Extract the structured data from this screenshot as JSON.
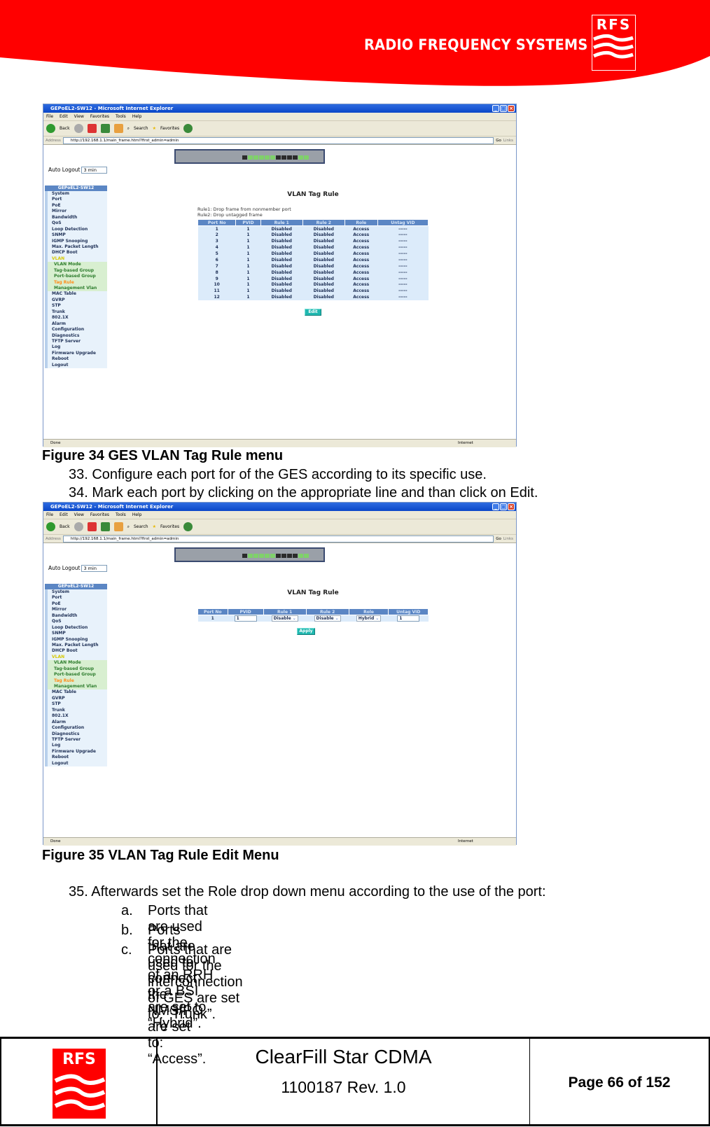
{
  "header": {
    "brand": "RADIO FREQUENCY SYSTEMS",
    "logo_text": "RFS",
    "brand_color": "#ff0000"
  },
  "browser": {
    "title": "GEPoEL2-SW12 - Microsoft Internet Explorer",
    "menu": [
      "File",
      "Edit",
      "View",
      "Favorites",
      "Tools",
      "Help"
    ],
    "toolbar": {
      "back": "Back",
      "search": "Search",
      "favorites": "Favorites"
    },
    "address_label": "Address",
    "url": "http://192.168.1.1/main_frame.html?first_admin=admin",
    "go": "Go",
    "links": "Links",
    "status": "Done",
    "zone": "Internet"
  },
  "app": {
    "auto_logout_label": "Auto Logout",
    "auto_logout_value": "3 min",
    "sidebar_title": "GEPoEL2-SW12",
    "sidebar": [
      {
        "label": "System"
      },
      {
        "label": "Port"
      },
      {
        "label": "PoE"
      },
      {
        "label": "Mirror"
      },
      {
        "label": "Bandwidth"
      },
      {
        "label": "QoS"
      },
      {
        "label": "Loop Detection"
      },
      {
        "label": "SNMP"
      },
      {
        "label": "IGMP Snooping"
      },
      {
        "label": "Max. Packet Length"
      },
      {
        "label": "DHCP Boot"
      },
      {
        "label": "VLAN",
        "type": "vlan"
      },
      {
        "label": "VLAN Mode",
        "type": "sub"
      },
      {
        "label": "Tag-based Group",
        "type": "sub"
      },
      {
        "label": "Port-based Group",
        "type": "sub"
      },
      {
        "label": "Tag Rule",
        "type": "sub active"
      },
      {
        "label": "Management Vlan",
        "type": "sub"
      },
      {
        "label": "MAC Table"
      },
      {
        "label": "GVRP"
      },
      {
        "label": "STP"
      },
      {
        "label": "Trunk"
      },
      {
        "label": "802.1X"
      },
      {
        "label": "Alarm"
      },
      {
        "label": "Configuration"
      },
      {
        "label": "Diagnostics"
      },
      {
        "label": "TFTP Server"
      },
      {
        "label": "Log"
      },
      {
        "label": "Firmware Upgrade"
      },
      {
        "label": "Reboot"
      },
      {
        "label": "Logout"
      }
    ],
    "page_title": "VLAN Tag Rule",
    "rule1": "Rule1: Drop frame from nonmember port",
    "rule2": "Rule2: Drop untagged frame",
    "columns": [
      "Port No",
      "PVID",
      "Rule 1",
      "Rule 2",
      "Role",
      "Untag VID"
    ],
    "rows": [
      [
        "1",
        "1",
        "Disabled",
        "Disabled",
        "Access",
        "-----"
      ],
      [
        "2",
        "1",
        "Disabled",
        "Disabled",
        "Access",
        "-----"
      ],
      [
        "3",
        "1",
        "Disabled",
        "Disabled",
        "Access",
        "-----"
      ],
      [
        "4",
        "1",
        "Disabled",
        "Disabled",
        "Access",
        "-----"
      ],
      [
        "5",
        "1",
        "Disabled",
        "Disabled",
        "Access",
        "-----"
      ],
      [
        "6",
        "1",
        "Disabled",
        "Disabled",
        "Access",
        "-----"
      ],
      [
        "7",
        "1",
        "Disabled",
        "Disabled",
        "Access",
        "-----"
      ],
      [
        "8",
        "1",
        "Disabled",
        "Disabled",
        "Access",
        "-----"
      ],
      [
        "9",
        "1",
        "Disabled",
        "Disabled",
        "Access",
        "-----"
      ],
      [
        "10",
        "1",
        "Disabled",
        "Disabled",
        "Access",
        "-----"
      ],
      [
        "11",
        "1",
        "Disabled",
        "Disabled",
        "Access",
        "-----"
      ],
      [
        "12",
        "1",
        "Disabled",
        "Disabled",
        "Access",
        "-----"
      ]
    ],
    "edit_label": "Edit",
    "edit_row": {
      "port": "1",
      "pvid": "1",
      "rule1": "Disable",
      "rule2": "Disable",
      "role": "Hybrid",
      "untag_vid": "1"
    },
    "apply_label": "Apply"
  },
  "doc": {
    "fig34": "Figure 34 GES VLAN Tag Rule menu",
    "step33": "33. Configure each port for of the GES according to its specific use.",
    "step34": "34. Mark each port by clicking on the appropriate line and than click on Edit.",
    "fig35": "Figure 35 VLAN Tag Rule Edit Menu",
    "step35": "35. Afterwards set the Role drop down menu according to the use of the port:",
    "items": [
      {
        "marker": "a.",
        "text": "Ports that are used for the connection of an RRH or a BSI are set to “Hybrid”."
      },
      {
        "marker": "b.",
        "text": "Ports that are used to connect the NMS/PC are set to: “Access”."
      },
      {
        "marker": "c.",
        "text": "Ports that are used for the interconnection of GES are set to: “Trunk”."
      }
    ]
  },
  "footer": {
    "logo_text": "RFS",
    "product": "ClearFill Star CDMA",
    "doc_number": "1100187 Rev. 1.0",
    "page": "Page 66 of 152"
  }
}
